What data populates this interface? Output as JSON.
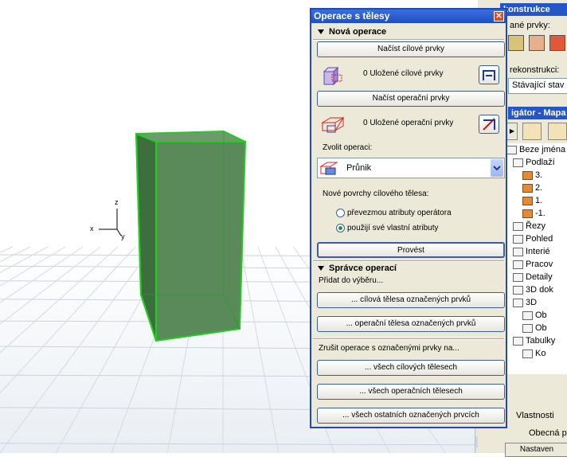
{
  "dialog": {
    "title": "Operace s tělesy",
    "close_icon": "close-icon",
    "nova_operace": {
      "heading": "Nová operace",
      "load_target_button": "Načíst cílové prvky",
      "saved_target": "0 Uložené cílové prvky",
      "load_operator_button": "Načíst operační prvky",
      "saved_operator": "0 Uložené operační prvky",
      "choose_operation_label": "Zvolit operaci:",
      "operation_selected": "Průnik",
      "new_surfaces_label": "Nové povrchy cílového tělesa:",
      "radio_take_operator": "převezmou atributy operátora",
      "radio_use_own": "použijí své vlastní atributy",
      "radio_selected": "use_own",
      "execute_button": "Provést"
    },
    "spravce": {
      "heading": "Správce operací",
      "add_label": "Přidat do výběru...",
      "add_target_button": "... cílová tělesa označených prvků",
      "add_operator_button": "... operační tělesa označených prvků",
      "cancel_label": "Zrušit operace s označenými prvky na...",
      "all_target_button": "... všech cílových tělesech",
      "all_operator_button": "... všech operačních tělesech",
      "all_other_button": "... všech ostatních označených prvcích"
    }
  },
  "side": {
    "konstrukce_title": "konstrukce",
    "prvky_label": "ané prvky:",
    "rekonstrukci_label": "rekonstrukci:",
    "stav_value": "Stávající stav",
    "navigator_title": "igátor - Mapa",
    "tree": [
      "Beze jména",
      "Podlaží",
      "3.",
      "2.",
      "1.",
      "-1.",
      "Řezy",
      "Pohled",
      "Interié",
      "Pracov",
      "Detaily",
      "3D dok",
      "3D",
      "Ob",
      "Ob",
      "Tabulky",
      "Ko"
    ],
    "vlastnosti_tab": "Vlastnosti",
    "obecna_label": "Obecná pa",
    "nastaveni_button": "Nastaven"
  },
  "axes": {
    "x": "x",
    "y": "y",
    "z": "z"
  },
  "colors": {
    "title_blue": "#1f4fc2",
    "box_green": "#4e8a4e",
    "box_edge": "#1ecf1e"
  }
}
